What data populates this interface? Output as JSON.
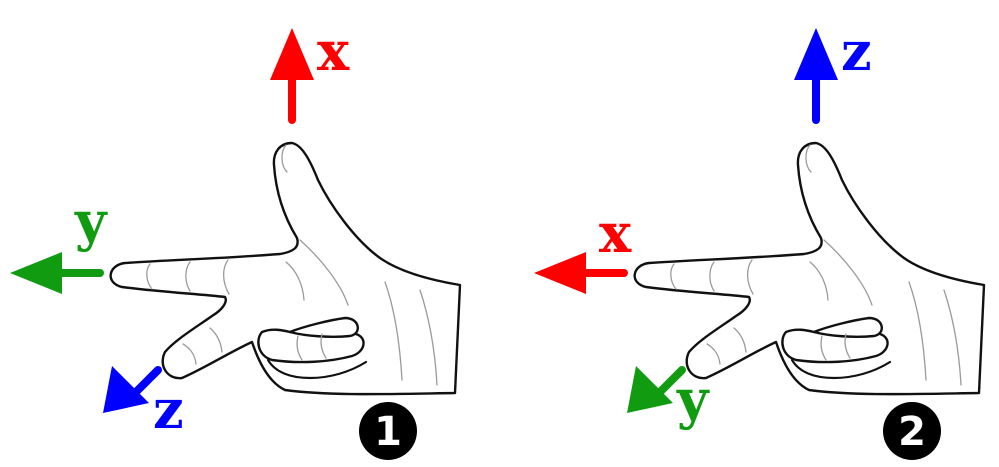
{
  "colors": {
    "x_axis": "#ff0000",
    "y_axis": "#119b11",
    "z_axis": "#0000ff",
    "badge": "#000000"
  },
  "panels": [
    {
      "badge": "1",
      "labels": {
        "up": "x",
        "left": "y",
        "down": "z"
      },
      "colors": {
        "up": "#ff0000",
        "left": "#119b11",
        "down": "#0000ff"
      }
    },
    {
      "badge": "2",
      "labels": {
        "up": "z",
        "left": "x",
        "down": "y"
      },
      "colors": {
        "up": "#0000ff",
        "left": "#ff0000",
        "down": "#119b11"
      }
    }
  ]
}
